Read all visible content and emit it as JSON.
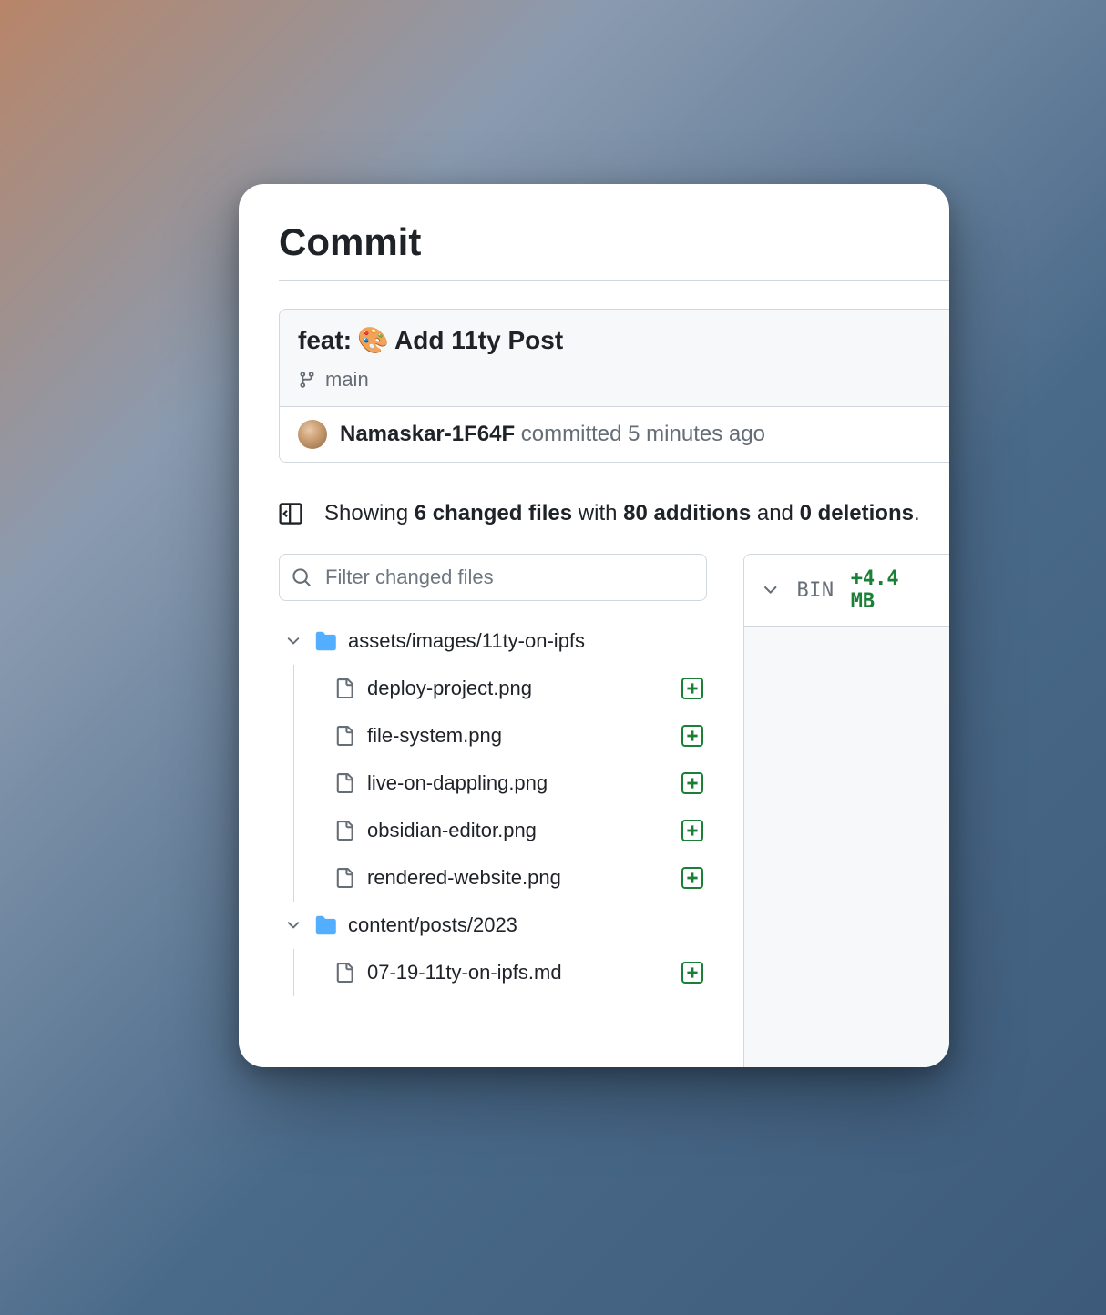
{
  "page": {
    "title": "Commit"
  },
  "commit": {
    "prefix": "feat:",
    "emoji": "🎨",
    "subject_rest": "Add 11ty Post",
    "branch": "main",
    "author": "Namaskar-1F64F",
    "committed_word": "committed",
    "time_ago": "5 minutes ago"
  },
  "summary": {
    "prefix": "Showing",
    "changed": "6 changed files",
    "with": "with",
    "additions": "80 additions",
    "and": "and",
    "deletions": "0 deletions",
    "suffix": "."
  },
  "filter": {
    "placeholder": "Filter changed files"
  },
  "tree": {
    "folders": [
      {
        "path": "assets/images/11ty-on-ipfs",
        "files": [
          {
            "name": "deploy-project.png",
            "status": "added"
          },
          {
            "name": "file-system.png",
            "status": "added"
          },
          {
            "name": "live-on-dappling.png",
            "status": "added"
          },
          {
            "name": "obsidian-editor.png",
            "status": "added"
          },
          {
            "name": "rendered-website.png",
            "status": "added"
          }
        ]
      },
      {
        "path": "content/posts/2023",
        "files": [
          {
            "name": "07-19-11ty-on-ipfs.md",
            "status": "added"
          }
        ]
      }
    ]
  },
  "diff": {
    "bin_label": "BIN",
    "size": "+4.4 MB"
  }
}
